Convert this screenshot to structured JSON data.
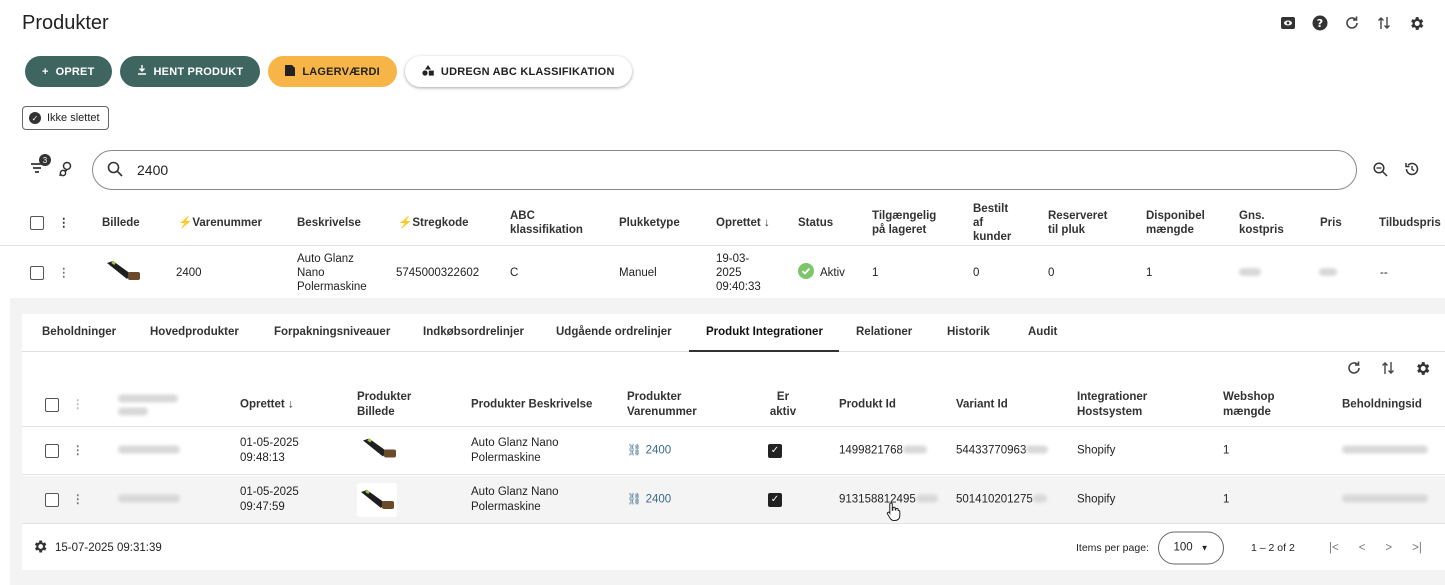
{
  "page": {
    "title": "Produkter"
  },
  "top_icons": [
    "eye-icon",
    "help-icon",
    "refresh-icon",
    "sort-icon",
    "gear-icon"
  ],
  "actions": {
    "create": "OPRET",
    "fetch_product": "HENT PRODUKT",
    "stock_value": "LAGERVÆRDI",
    "abc": "UDREGN ABC KLASSIFIKATION"
  },
  "filter_chip": {
    "label": "Ikke slettet"
  },
  "filter_badge": "3",
  "search": {
    "value": "2400"
  },
  "table": {
    "headers": {
      "image": "Billede",
      "item_no": "Varenummer",
      "description": "Beskrivelse",
      "barcode": "Stregkode",
      "abc": "ABC klassifikation",
      "pick_type": "Plukketype",
      "created": "Oprettet",
      "status": "Status",
      "available": "Tilgængelig på lageret",
      "ordered": "Bestilt af kunder",
      "reserved": "Reserveret til pluk",
      "disposable": "Disponibel mængde",
      "avg_cost": "Gns. kostpris",
      "price": "Pris",
      "offer_price": "Tilbudspris"
    },
    "row": {
      "item_no": "2400",
      "description": "Auto Glanz Nano Polermaskine",
      "barcode": "5745000322602",
      "abc": "C",
      "pick_type": "Manuel",
      "created": "19-03-2025 09:40:33",
      "status": "Aktiv",
      "available": "1",
      "ordered": "0",
      "reserved": "0",
      "disposable": "1",
      "offer_price": "--"
    }
  },
  "tabs": [
    "Beholdninger",
    "Hovedprodukter",
    "Forpakningsniveauer",
    "Indkøbsordrelinjer",
    "Udgående ordrelinjer",
    "Produkt Integrationer",
    "Relationer",
    "Historik",
    "Audit"
  ],
  "active_tab": "Produkt Integrationer",
  "sub_table": {
    "headers": {
      "created": "Oprettet",
      "image": "Produkter Billede",
      "description": "Produkter Beskrivelse",
      "item_no": "Produkter Varenummer",
      "active": "Er aktiv",
      "product_id": "Produkt Id",
      "variant_id": "Variant Id",
      "host": "Integrationer Hostsystem",
      "webshop_qty": "Webshop mængde",
      "stock_id": "Beholdningsid"
    },
    "rows": [
      {
        "created": "01-05-2025 09:48:13",
        "description": "Auto Glanz Nano Polermaskine",
        "item_no": "2400",
        "active": true,
        "product_id": "1499821768",
        "variant_id": "54433770963",
        "host": "Shopify",
        "webshop_qty": "1"
      },
      {
        "created": "01-05-2025 09:47:59",
        "description": "Auto Glanz Nano Polermaskine",
        "item_no": "2400",
        "active": true,
        "product_id": "913158812495",
        "variant_id": "501410201275",
        "host": "Shopify",
        "webshop_qty": "1"
      }
    ]
  },
  "footer": {
    "timestamp": "15-07-2025 09:31:39",
    "items_per_page_label": "Items per page:",
    "items_per_page": "100",
    "range": "1 – 2 of 2"
  },
  "colors": {
    "primary": "#3f6561",
    "accent": "#f7b548",
    "success": "#7cc56b",
    "link": "#3a6a8c"
  }
}
